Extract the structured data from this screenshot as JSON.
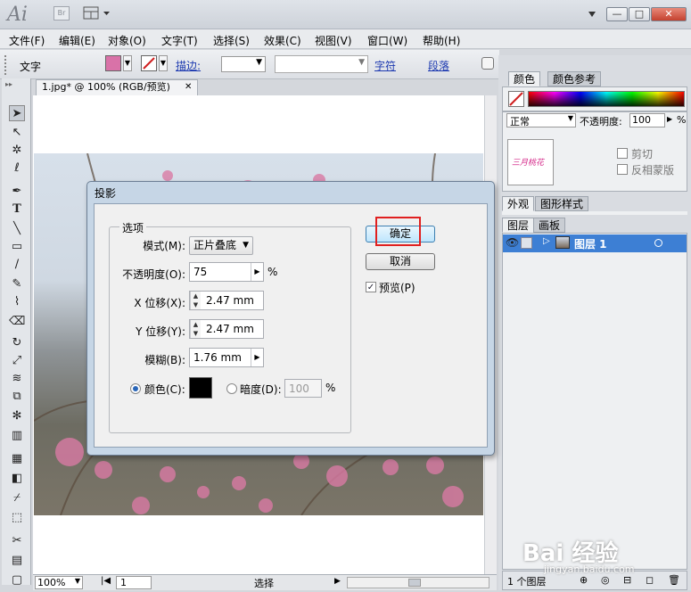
{
  "app": {
    "logo": "Ai",
    "bridge_label": "Br"
  },
  "menu": [
    "文件(F)",
    "编辑(E)",
    "对象(O)",
    "文字(T)",
    "选择(S)",
    "效果(C)",
    "视图(V)",
    "窗口(W)",
    "帮助(H)"
  ],
  "control_bar": {
    "type_label": "文字",
    "stroke_label": "描边:",
    "char_link": "字符",
    "para_link": "段落"
  },
  "document": {
    "tab_title": "1.jpg* @ 100% (RGB/预览)",
    "zoom": "100%",
    "page": "1",
    "status": "选择"
  },
  "panels": {
    "color_tab": "颜色",
    "color_guide_tab": "颜色参考",
    "blend_mode": "正常",
    "opacity_label": "不透明度:",
    "opacity_value": "100",
    "opacity_unit": "%",
    "clip_label": "剪切",
    "invert_mask_label": "反相蒙版",
    "thumb_text": "三月桃花",
    "appearance_tab": "外观",
    "graphic_styles_tab": "图形样式",
    "layers_tab": "图层",
    "artboards_tab": "画板",
    "layer_name": "图层 1",
    "layers_count": "1 个图层"
  },
  "dialog": {
    "title": "投影",
    "group_label": "选项",
    "mode_label": "模式(M):",
    "mode_value": "正片叠底",
    "opacity_label": "不透明度(O):",
    "opacity_value": "75",
    "opacity_unit": "%",
    "x_offset_label": "X 位移(X):",
    "x_offset_value": "2.47 mm",
    "y_offset_label": "Y 位移(Y):",
    "y_offset_value": "2.47 mm",
    "blur_label": "模糊(B):",
    "blur_value": "1.76 mm",
    "color_label": "颜色(C):",
    "darkness_label": "暗度(D):",
    "darkness_value": "100",
    "darkness_unit": "%",
    "ok_label": "确定",
    "cancel_label": "取消",
    "preview_label": "预览(P)",
    "shadow_color": "#000000"
  },
  "watermark": {
    "text": "Bai 经验",
    "url": "jingyan.baidu.com"
  },
  "colors": {
    "fill": "#d972a8",
    "accent": "#1c39b0",
    "highlight": "#e02020"
  }
}
